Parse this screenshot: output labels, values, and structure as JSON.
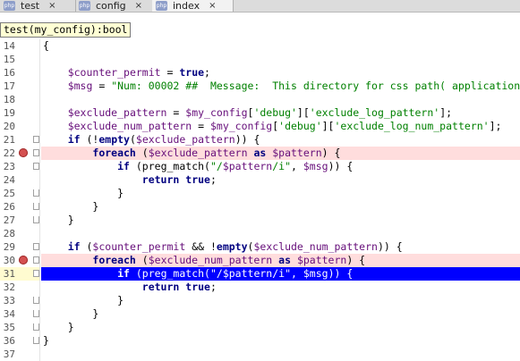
{
  "tabs": [
    {
      "icon_text": "php",
      "label": "test",
      "active": false
    },
    {
      "icon_text": "php",
      "label": "config",
      "active": false
    },
    {
      "icon_text": "php",
      "label": "index",
      "active": true
    }
  ],
  "tab_close_glyph": "×",
  "tooltip": "test(my_config):bool",
  "lines": [
    {
      "n": "14",
      "tokens": [
        [
          "",
          "{"
        ]
      ]
    },
    {
      "n": "15",
      "tokens": []
    },
    {
      "n": "16",
      "tokens": [
        [
          "",
          "    "
        ],
        [
          "var",
          "$counter_permit"
        ],
        [
          "",
          " = "
        ],
        [
          "kw",
          "true"
        ],
        [
          "",
          ";"
        ]
      ]
    },
    {
      "n": "17",
      "tokens": [
        [
          "",
          "    "
        ],
        [
          "var",
          "$msg"
        ],
        [
          "",
          " = "
        ],
        [
          "str",
          "\"Num: 00002 ##  Message:  This directory for css path( application"
        ]
      ]
    },
    {
      "n": "18",
      "tokens": []
    },
    {
      "n": "19",
      "tokens": [
        [
          "",
          "    "
        ],
        [
          "var",
          "$exclude_pattern"
        ],
        [
          "",
          " = "
        ],
        [
          "var",
          "$my_config"
        ],
        [
          "",
          "["
        ],
        [
          "str",
          "'debug'"
        ],
        [
          "",
          "]["
        ],
        [
          "str",
          "'exclude_log_pattern'"
        ],
        [
          "",
          "];"
        ]
      ]
    },
    {
      "n": "20",
      "tokens": [
        [
          "",
          "    "
        ],
        [
          "var",
          "$exclude_num_pattern"
        ],
        [
          "",
          " = "
        ],
        [
          "var",
          "$my_config"
        ],
        [
          "",
          "["
        ],
        [
          "str",
          "'debug'"
        ],
        [
          "",
          "]["
        ],
        [
          "str",
          "'exclude_log_num_pattern'"
        ],
        [
          "",
          "];"
        ]
      ]
    },
    {
      "n": "21",
      "tokens": [
        [
          "",
          "    "
        ],
        [
          "kw",
          "if"
        ],
        [
          "",
          " (!"
        ],
        [
          "kw",
          "empty"
        ],
        [
          "",
          "("
        ],
        [
          "var",
          "$exclude_pattern"
        ],
        [
          "",
          ")) {"
        ]
      ]
    },
    {
      "n": "22",
      "tokens": [
        [
          "",
          "        "
        ],
        [
          "kw",
          "foreach"
        ],
        [
          "",
          " ("
        ],
        [
          "var",
          "$exclude_pattern"
        ],
        [
          "",
          " "
        ],
        [
          "kw",
          "as"
        ],
        [
          "",
          " "
        ],
        [
          "var",
          "$pattern"
        ],
        [
          "",
          ") {"
        ]
      ]
    },
    {
      "n": "23",
      "tokens": [
        [
          "",
          "            "
        ],
        [
          "kw",
          "if"
        ],
        [
          "",
          " (preg_match("
        ],
        [
          "str",
          "\"/"
        ],
        [
          "var",
          "$pattern"
        ],
        [
          "str",
          "/i\""
        ],
        [
          "",
          ", "
        ],
        [
          "var",
          "$msg"
        ],
        [
          "",
          ")) {"
        ]
      ]
    },
    {
      "n": "24",
      "tokens": [
        [
          "",
          "                "
        ],
        [
          "kw",
          "return"
        ],
        [
          "",
          " "
        ],
        [
          "kw",
          "true"
        ],
        [
          "",
          ";"
        ]
      ]
    },
    {
      "n": "25",
      "tokens": [
        [
          "",
          "            }"
        ]
      ]
    },
    {
      "n": "26",
      "tokens": [
        [
          "",
          "        }"
        ]
      ]
    },
    {
      "n": "27",
      "tokens": [
        [
          "",
          "    }"
        ]
      ]
    },
    {
      "n": "28",
      "tokens": []
    },
    {
      "n": "29",
      "tokens": [
        [
          "",
          "    "
        ],
        [
          "kw",
          "if"
        ],
        [
          "",
          " ("
        ],
        [
          "var",
          "$counter_permit"
        ],
        [
          "",
          " && !"
        ],
        [
          "kw",
          "empty"
        ],
        [
          "",
          "("
        ],
        [
          "var",
          "$exclude_num_pattern"
        ],
        [
          "",
          ")) {"
        ]
      ]
    },
    {
      "n": "30",
      "tokens": [
        [
          "",
          "        "
        ],
        [
          "kw",
          "foreach"
        ],
        [
          "",
          " ("
        ],
        [
          "var",
          "$exclude_num_pattern"
        ],
        [
          "",
          " "
        ],
        [
          "kw",
          "as"
        ],
        [
          "",
          " "
        ],
        [
          "var",
          "$pattern"
        ],
        [
          "",
          ") {"
        ]
      ]
    },
    {
      "n": "31",
      "tokens": [
        [
          "",
          "            "
        ],
        [
          "kw",
          "if"
        ],
        [
          "",
          " (preg_match("
        ],
        [
          "str",
          "\"/"
        ],
        [
          "var",
          "$pattern"
        ],
        [
          "str",
          "/i\""
        ],
        [
          "",
          ", "
        ],
        [
          "var",
          "$msg"
        ],
        [
          "",
          ")) {"
        ]
      ]
    },
    {
      "n": "32",
      "tokens": [
        [
          "",
          "                "
        ],
        [
          "kw",
          "return"
        ],
        [
          "",
          " "
        ],
        [
          "kw",
          "true"
        ],
        [
          "",
          ";"
        ]
      ]
    },
    {
      "n": "33",
      "tokens": [
        [
          "",
          "            }"
        ]
      ]
    },
    {
      "n": "34",
      "tokens": [
        [
          "",
          "        }"
        ]
      ]
    },
    {
      "n": "35",
      "tokens": [
        [
          "",
          "    }"
        ]
      ]
    },
    {
      "n": "36",
      "tokens": [
        [
          "",
          "}"
        ]
      ]
    },
    {
      "n": "37",
      "tokens": []
    }
  ],
  "breakpoint_lines": [
    "22",
    "30"
  ],
  "execution_line": "31",
  "fold_open_lines": [
    "21",
    "22",
    "23",
    "29",
    "30",
    "31"
  ],
  "fold_end_lines": [
    "25",
    "26",
    "27",
    "33",
    "34",
    "35",
    "36"
  ],
  "icons": {
    "breakpoint": "breakpoint-icon",
    "fold": "fold-marker-icon",
    "file": "php-file-icon",
    "close": "close-icon"
  },
  "colors": {
    "keyword": "#000080",
    "variable": "#660e7a",
    "string": "#008000",
    "breakpoint_line": "#ffdddd",
    "execution_line": "#0000ff"
  }
}
